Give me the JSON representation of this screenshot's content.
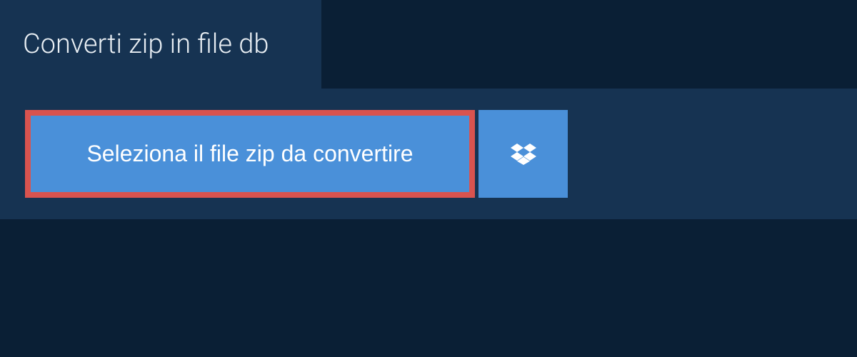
{
  "header": {
    "title": "Converti zip in file db"
  },
  "actions": {
    "select_file_label": "Seleziona il file zip da convertire"
  },
  "colors": {
    "background_dark": "#0a1f35",
    "panel": "#163352",
    "button_primary": "#4a90d9",
    "highlight_border": "#d9534f",
    "text_light": "#e8eef3"
  }
}
